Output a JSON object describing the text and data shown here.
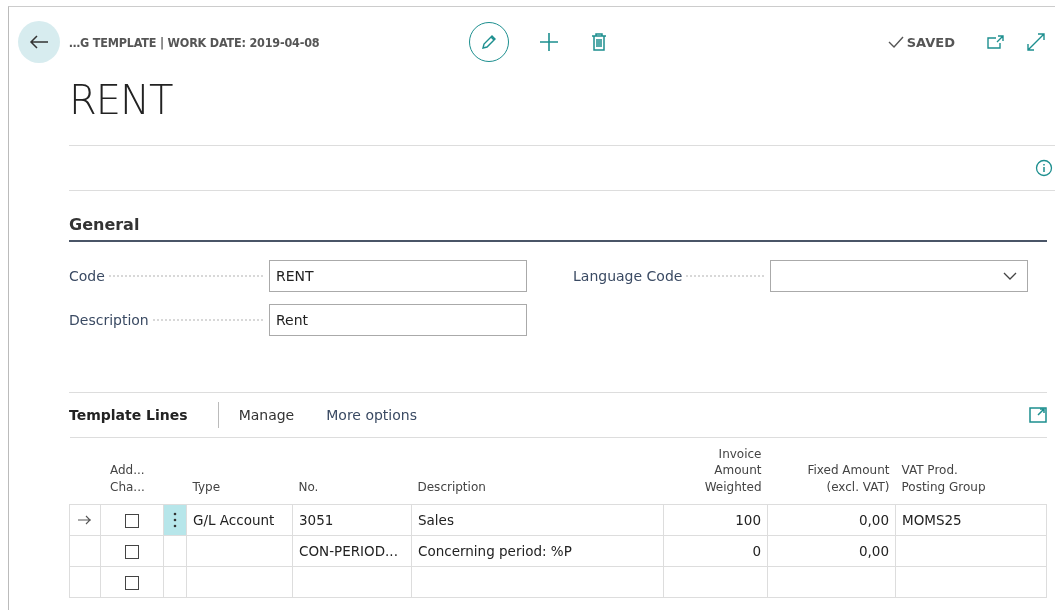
{
  "header": {
    "breadcrumb": "…G TEMPLATE | WORK DATE: 2019-04-08",
    "title": "RENT",
    "status": "SAVED"
  },
  "general": {
    "heading": "General",
    "fields": [
      {
        "label": "Code",
        "value": "RENT",
        "kind": "text"
      },
      {
        "label": "Language Code",
        "kind": "dropdown"
      },
      {
        "label": "Description",
        "value": "Rent",
        "kind": "text"
      }
    ]
  },
  "lines": {
    "title": "Template Lines",
    "actions": [
      "Manage",
      "More options"
    ],
    "checkbox_column": "Add... Cha...",
    "columns": [
      "Type",
      "No.",
      "Description",
      "Invoice Amount Weighted",
      "Fixed Amount (excl. VAT)",
      "VAT Prod. Posting Group"
    ],
    "rows": [
      {
        "selected": true,
        "checked": false,
        "cells": [
          "G/L Account",
          "3051",
          "Sales",
          "100",
          "0,00",
          "MOMS25"
        ]
      },
      {
        "selected": false,
        "checked": false,
        "cells": [
          "",
          "CON-PERIOD...",
          "Concerning period: %P",
          "0",
          "0,00",
          ""
        ]
      },
      {
        "selected": false,
        "checked": false,
        "cells": [
          "",
          "",
          "",
          "",
          "",
          ""
        ]
      }
    ]
  }
}
